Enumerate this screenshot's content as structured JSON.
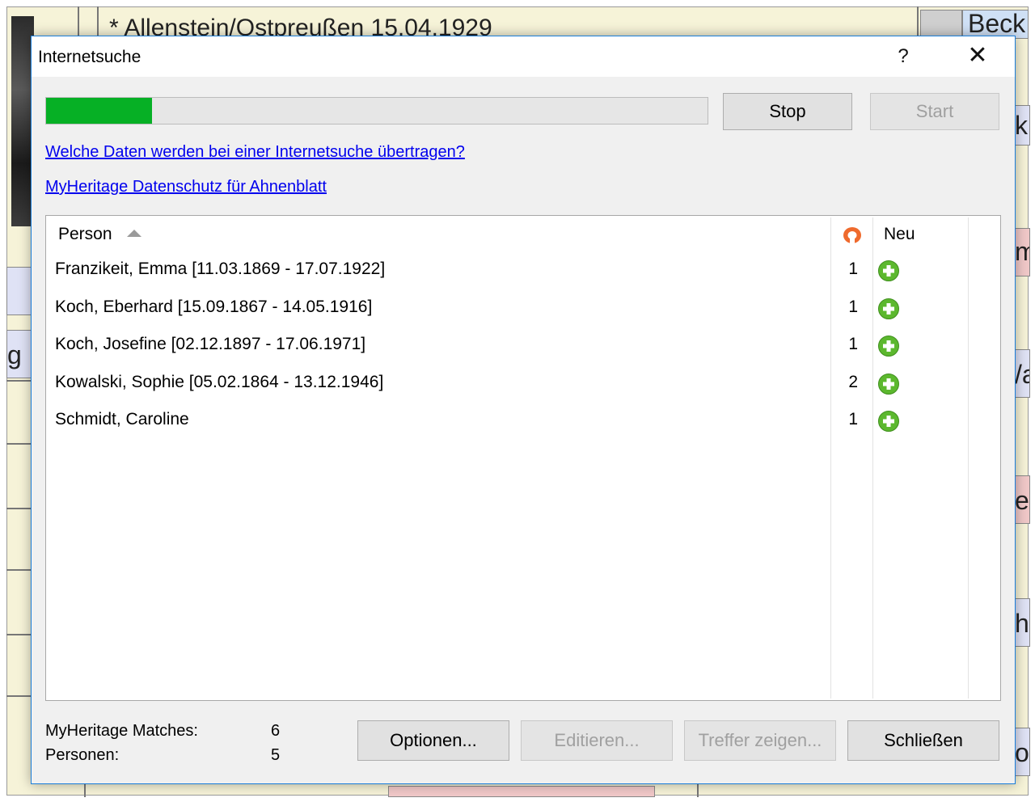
{
  "background": {
    "top_text": "* Allenstein/Ostpreußen 15.04.1929",
    "corner_text": "Beck",
    "fragments": [
      "k",
      "m",
      "g",
      "/a",
      "er",
      "h",
      "o"
    ]
  },
  "dialog": {
    "title": "Internetsuche",
    "help_label": "?",
    "close_label": "✕",
    "progress_fraction": 0.16,
    "stop_label": "Stop",
    "start_label": "Start",
    "link_data_info": "Welche Daten werden bei einer Internetsuche übertragen?",
    "link_privacy": "MyHeritage Datenschutz für Ahnenblatt",
    "list": {
      "header_person": "Person",
      "header_match_icon": "myheritage-icon",
      "header_new": "Neu",
      "rows": [
        {
          "person": "Franzikeit, Emma [11.03.1869 - 17.07.1922]",
          "count": "1",
          "icon": "add-icon"
        },
        {
          "person": "Koch, Eberhard [15.09.1867 - 14.05.1916]",
          "count": "1",
          "icon": "add-icon"
        },
        {
          "person": "Koch, Josefine [02.12.1897 - 17.06.1971]",
          "count": "1",
          "icon": "add-icon"
        },
        {
          "person": "Kowalski, Sophie [05.02.1864 - 13.12.1946]",
          "count": "2",
          "icon": "add-icon"
        },
        {
          "person": "Schmidt, Caroline",
          "count": "1",
          "icon": "add-icon"
        }
      ]
    },
    "summary": {
      "matches_label": "MyHeritage Matches:",
      "matches_value": "6",
      "persons_label": "Personen:",
      "persons_value": "5"
    },
    "buttons": {
      "options": "Optionen...",
      "edit": "Editieren...",
      "show_hits": "Treffer zeigen...",
      "close": "Schließen"
    },
    "colors": {
      "progress": "#06b025",
      "link": "#0000ee",
      "accent_border": "#1a7dd9",
      "add_icon": "#5cb82e",
      "myheritage_icon": "#ef6a2d"
    }
  }
}
